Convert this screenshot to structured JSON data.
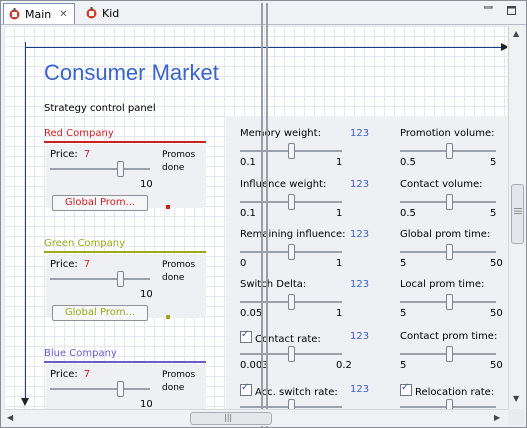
{
  "tabs": [
    {
      "label": "Main",
      "active": true,
      "icon": "model-icon"
    },
    {
      "label": "Kid",
      "active": false,
      "icon": "model-icon"
    }
  ],
  "canvas": {
    "title": "Consumer Market",
    "subtitle": "Strategy control panel"
  },
  "companies": [
    {
      "name": "Red Company",
      "color": "#cc2222",
      "price_label": "Price:",
      "price": "7",
      "promos_line1": "Promos",
      "promos_line2": "done",
      "slider_max": "10",
      "slider_fraction": 0.7,
      "button_label": "Global Prom..."
    },
    {
      "name": "Green Company",
      "color": "#9aaa1a",
      "price_label": "Price:",
      "price": "7",
      "promos_line1": "Promos",
      "promos_line2": "done",
      "slider_max": "10",
      "slider_fraction": 0.7,
      "button_label": "Global Prom..."
    },
    {
      "name": "Blue Company",
      "color": "#6a5acd",
      "price_label": "Price:",
      "price": "7",
      "promos_line1": "Promos",
      "promos_line2": "done",
      "slider_max": "10",
      "slider_fraction": 0.7,
      "button_label": ""
    }
  ],
  "params_left": [
    {
      "label": "Memory weight:",
      "value": "123",
      "min": "0.1",
      "max": "1",
      "checkbox": false
    },
    {
      "label": "Influence weight:",
      "value": "123",
      "min": "0.1",
      "max": "1",
      "checkbox": false
    },
    {
      "label": "Remaining influence:",
      "value": "123",
      "min": "0",
      "max": "1",
      "checkbox": false
    },
    {
      "label": "Switch Delta:",
      "value": "123",
      "min": "0.05",
      "max": "1",
      "checkbox": false
    },
    {
      "label": "Contact rate:",
      "value": "123",
      "min": "0.003",
      "max": "0.2",
      "checkbox": true
    },
    {
      "label": "Acc. switch rate:",
      "value": "123",
      "min": "",
      "max": "",
      "checkbox": true
    }
  ],
  "params_right": [
    {
      "label": "Promotion volume:",
      "min": "0.5",
      "max": "5",
      "checkbox": false
    },
    {
      "label": "Contact volume:",
      "min": "0.5",
      "max": "5",
      "checkbox": false
    },
    {
      "label": "Global prom time:",
      "min": "5",
      "max": "50",
      "checkbox": false
    },
    {
      "label": "Local prom time:",
      "min": "5",
      "max": "50",
      "checkbox": false
    },
    {
      "label": "Contact prom time:",
      "min": "5",
      "max": "50",
      "checkbox": false
    },
    {
      "label": "Relocation rate:",
      "min": "",
      "max": "",
      "checkbox": true
    }
  ],
  "scrollbar": {
    "grip": "|||"
  }
}
